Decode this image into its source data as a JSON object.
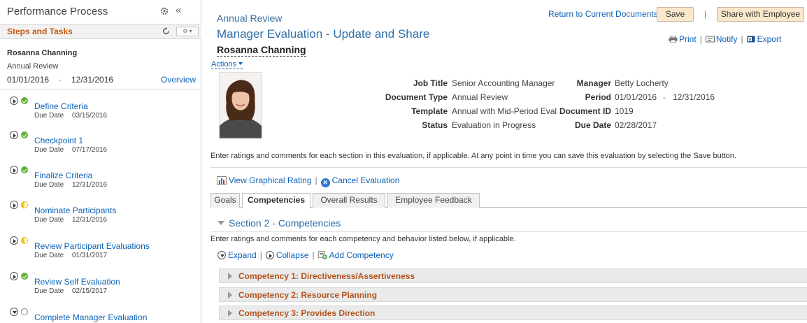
{
  "left_panel": {
    "title": "Performance Process",
    "collapse_glyph": "«",
    "steps_title": "Steps and Tasks",
    "person_name": "Rosanna Channing",
    "document_type": "Annual Review",
    "date_from": "01/01/2016",
    "date_dash": "-",
    "date_to": "12/31/2016",
    "overview_link": "Overview",
    "due_label": "Due Date",
    "tasks": [
      {
        "name": "Define Criteria",
        "due": "03/15/2016",
        "status": "complete"
      },
      {
        "name": "Checkpoint 1",
        "due": "07/17/2016",
        "status": "complete"
      },
      {
        "name": "Finalize Criteria",
        "due": "12/31/2016",
        "status": "complete"
      },
      {
        "name": "Nominate Participants",
        "due": "12/31/2016",
        "status": "in-progress"
      },
      {
        "name": "Review Participant Evaluations",
        "due": "01/31/2017",
        "status": "in-progress"
      },
      {
        "name": "Review Self Evaluation",
        "due": "02/15/2017",
        "status": "complete"
      },
      {
        "name": "Complete Manager Evaluation",
        "due": "",
        "status": "not-started"
      }
    ]
  },
  "header": {
    "breadcrumb": "Annual Review",
    "return_link": "Return to Current Documents",
    "save_label": "Save",
    "share_label": "Share with Employee",
    "pipe": "|",
    "page_title": "Manager Evaluation - Update and Share",
    "employee_name": "Rosanna Channing",
    "print_label": "Print",
    "notify_label": "Notify",
    "export_label": "Export",
    "actions_label": "Actions"
  },
  "document_info": {
    "job_title_label": "Job Title",
    "job_title": "Senior Accounting Manager",
    "document_type_label": "Document Type",
    "document_type": "Annual Review",
    "template_label": "Template",
    "template": "Annual with Mid-Period Eval",
    "status_label": "Status",
    "status": "Evaluation in Progress",
    "manager_label": "Manager",
    "manager": "Betty Locherty",
    "period_label": "Period",
    "period_from": "01/01/2016",
    "period_dash": "-",
    "period_to": "12/31/2016",
    "document_id_label": "Document ID",
    "document_id": "1019",
    "due_date_label": "Due Date",
    "due_date": "02/28/2017"
  },
  "instructions": "Enter ratings and comments for each section in this evaluation, if applicable. At any point in time you can save this evaluation by selecting the Save button.",
  "links": {
    "graphical_rating": "View Graphical Rating",
    "cancel_evaluation": "Cancel Evaluation"
  },
  "tabs": [
    "Goals",
    "Competencies",
    "Overall Results",
    "Employee Feedback"
  ],
  "active_tab": "Competencies",
  "section": {
    "title": "Section 2 - Competencies",
    "instructions": "Enter ratings and comments for each competency and behavior listed below, if applicable.",
    "expand_label": "Expand",
    "collapse_label": "Collapse",
    "add_label": "Add Competency",
    "competencies": [
      "Competency 1: Directiveness/Assertiveness",
      "Competency 2: Resource Planning",
      "Competency 3: Provides Direction"
    ]
  },
  "colors": {
    "link": "#0d62b7",
    "steps_title": "#c55a11",
    "competency_title": "#b3541e",
    "complete": "#5fb237",
    "in_progress": "#f5c518",
    "button_bg": "#fbe8cc"
  },
  "icons": [
    "gear-icon",
    "refresh-icon",
    "print-icon",
    "notify-icon",
    "export-icon",
    "graph-icon",
    "cancel-icon",
    "add-icon"
  ]
}
